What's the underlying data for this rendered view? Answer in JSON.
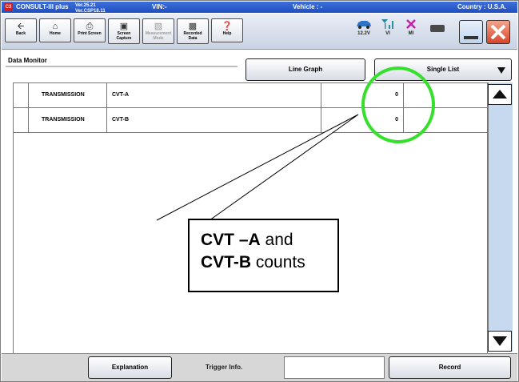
{
  "titlebar": {
    "logo": "C3",
    "app": "CONSULT-III plus",
    "ver1": "Ver.25.21",
    "ver2": "Ver.CSP18.11",
    "vin": "VIN:-",
    "vehicle": "Vehicle : -",
    "country": "Country : U.S.A."
  },
  "toolbar": {
    "back": "Back",
    "home": "Home",
    "print": "Print Screen",
    "capture1": "Screen",
    "capture2": "Capture",
    "measure1": "Measurement",
    "measure2": "Mode",
    "recorded1": "Recorded",
    "recorded2": "Data",
    "help": "Help",
    "battery": "12.2V",
    "vi": "VI",
    "mi": "MI"
  },
  "header": {
    "title": "Data Monitor",
    "line_graph": "Line Graph",
    "single_list": "Single List"
  },
  "rows": [
    {
      "system": "TRANSMISSION",
      "item": "CVT-A",
      "value": "0"
    },
    {
      "system": "TRANSMISSION",
      "item": "CVT-B",
      "value": "0"
    }
  ],
  "bottom": {
    "explanation": "Explanation",
    "trigger": "Trigger Info.",
    "record": "Record"
  },
  "callout": {
    "a_bold": "CVT –A",
    "a_rest": " and",
    "b_bold": "CVT-B",
    "b_rest": " counts"
  },
  "colors": {
    "highlight_circle": "#35e02c",
    "titlebar": "#1d4fc3",
    "scrollbar": "#c7d9ef"
  }
}
